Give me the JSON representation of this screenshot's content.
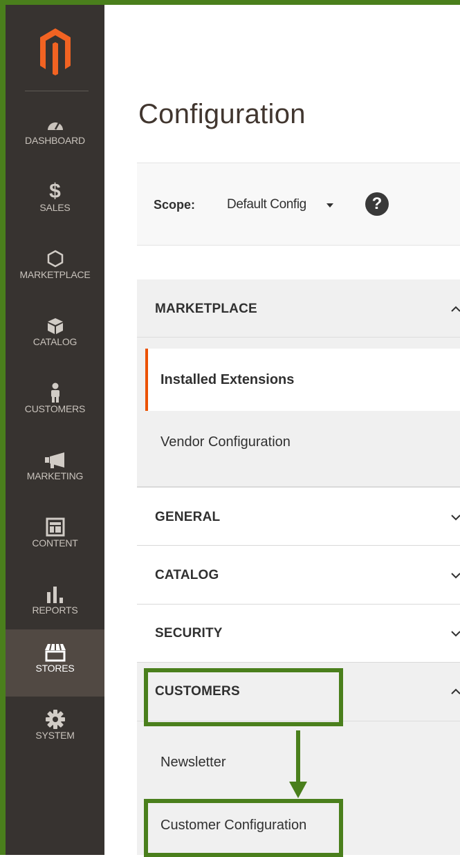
{
  "colors": {
    "sidebar": "#373330",
    "accent": "#eb5202",
    "highlight": "#4a7f1c"
  },
  "sidebar": {
    "logo": "magento-logo",
    "items": [
      {
        "label": "DASHBOARD",
        "icon": "gauge-icon"
      },
      {
        "label": "SALES",
        "icon": "dollar-icon"
      },
      {
        "label": "MARKETPLACE",
        "icon": "hexagon-icon"
      },
      {
        "label": "CATALOG",
        "icon": "box-icon"
      },
      {
        "label": "CUSTOMERS",
        "icon": "person-icon"
      },
      {
        "label": "MARKETING",
        "icon": "megaphone-icon"
      },
      {
        "label": "CONTENT",
        "icon": "layout-icon"
      },
      {
        "label": "REPORTS",
        "icon": "bar-chart-icon"
      },
      {
        "label": "STORES",
        "icon": "storefront-icon",
        "active": true
      },
      {
        "label": "SYSTEM",
        "icon": "gear-icon"
      }
    ]
  },
  "page": {
    "title": "Configuration"
  },
  "scope": {
    "label": "Scope:",
    "value": "Default Config"
  },
  "sections": {
    "marketplace": {
      "title": "MARKETPLACE",
      "items": [
        "Installed Extensions",
        "Vendor Configuration"
      ]
    },
    "general": {
      "title": "GENERAL"
    },
    "catalog": {
      "title": "CATALOG"
    },
    "security": {
      "title": "SECURITY"
    },
    "customers": {
      "title": "CUSTOMERS",
      "items": [
        "Newsletter",
        "Customer Configuration"
      ]
    }
  }
}
